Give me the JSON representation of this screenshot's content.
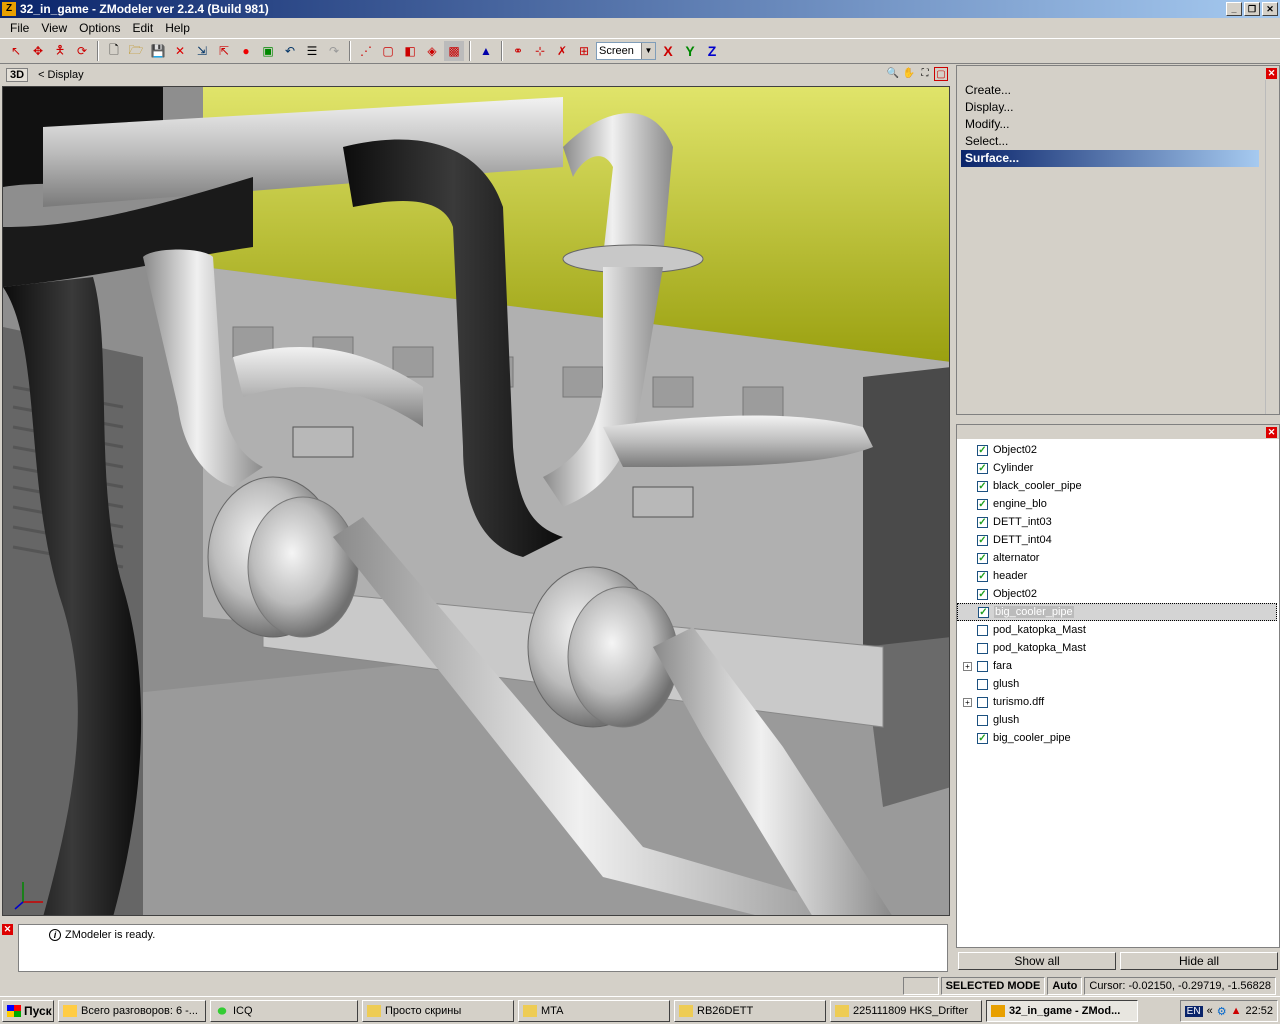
{
  "window": {
    "title": "32_in_game - ZModeler ver 2.2.4 (Build 981)",
    "app_icon": "Z"
  },
  "menu": [
    "File",
    "View",
    "Options",
    "Edit",
    "Help"
  ],
  "toolbar": {
    "view_mode": "Screen",
    "axes": [
      "X",
      "Y",
      "Z"
    ]
  },
  "viewport": {
    "mode": "3D",
    "breadcrumb": "< Display"
  },
  "commands": {
    "items": [
      "Create...",
      "Display...",
      "Modify...",
      "Select...",
      "Surface..."
    ],
    "active_index": 4
  },
  "objects": [
    {
      "name": "Object02",
      "checked": true,
      "expandable": false
    },
    {
      "name": "Cylinder",
      "checked": true,
      "expandable": false
    },
    {
      "name": "black_cooler_pipe",
      "checked": true,
      "expandable": false
    },
    {
      "name": "engine_blo",
      "checked": true,
      "expandable": false
    },
    {
      "name": "DETT_int03",
      "checked": true,
      "expandable": false
    },
    {
      "name": "DETT_int04",
      "checked": true,
      "expandable": false
    },
    {
      "name": "alternator",
      "checked": true,
      "expandable": false
    },
    {
      "name": "header",
      "checked": true,
      "expandable": false
    },
    {
      "name": "Object02",
      "checked": true,
      "expandable": false
    },
    {
      "name": "big_cooler_pipe",
      "checked": true,
      "expandable": false,
      "selected": true
    },
    {
      "name": "pod_katopka_Mast",
      "checked": false,
      "expandable": false
    },
    {
      "name": "pod_katopka_Mast",
      "checked": false,
      "expandable": false
    },
    {
      "name": "fara",
      "checked": false,
      "expandable": true
    },
    {
      "name": "glush",
      "checked": false,
      "expandable": false
    },
    {
      "name": "turismo.dff",
      "checked": false,
      "expandable": true
    },
    {
      "name": "glush",
      "checked": false,
      "expandable": false
    },
    {
      "name": "big_cooler_pipe",
      "checked": true,
      "expandable": false
    }
  ],
  "object_buttons": {
    "show_all": "Show all",
    "hide_all": "Hide all"
  },
  "log": {
    "message": "ZModeler is ready."
  },
  "status": {
    "mode": "SELECTED MODE",
    "auto": "Auto",
    "cursor": "Cursor: -0.02150, -0.29719, -1.56828"
  },
  "taskbar": {
    "start": "Пуск",
    "tasks": [
      {
        "label": "Всего разговоров: 6 -...",
        "active": false
      },
      {
        "label": "ICQ",
        "active": false
      },
      {
        "label": "Просто скрины",
        "active": false
      },
      {
        "label": "MTA",
        "active": false
      },
      {
        "label": "RB26DETT",
        "active": false
      },
      {
        "label": "225111809 HKS_Drifter",
        "active": false
      },
      {
        "label": "32_in_game - ZMod...",
        "active": true
      }
    ],
    "lang": "EN",
    "clock": "22:52"
  },
  "colors": {
    "accent": "#0a246a",
    "engine_cover": "#c8cc30",
    "pipe_chrome": "#c8c8c8",
    "pipe_black": "#222222"
  }
}
